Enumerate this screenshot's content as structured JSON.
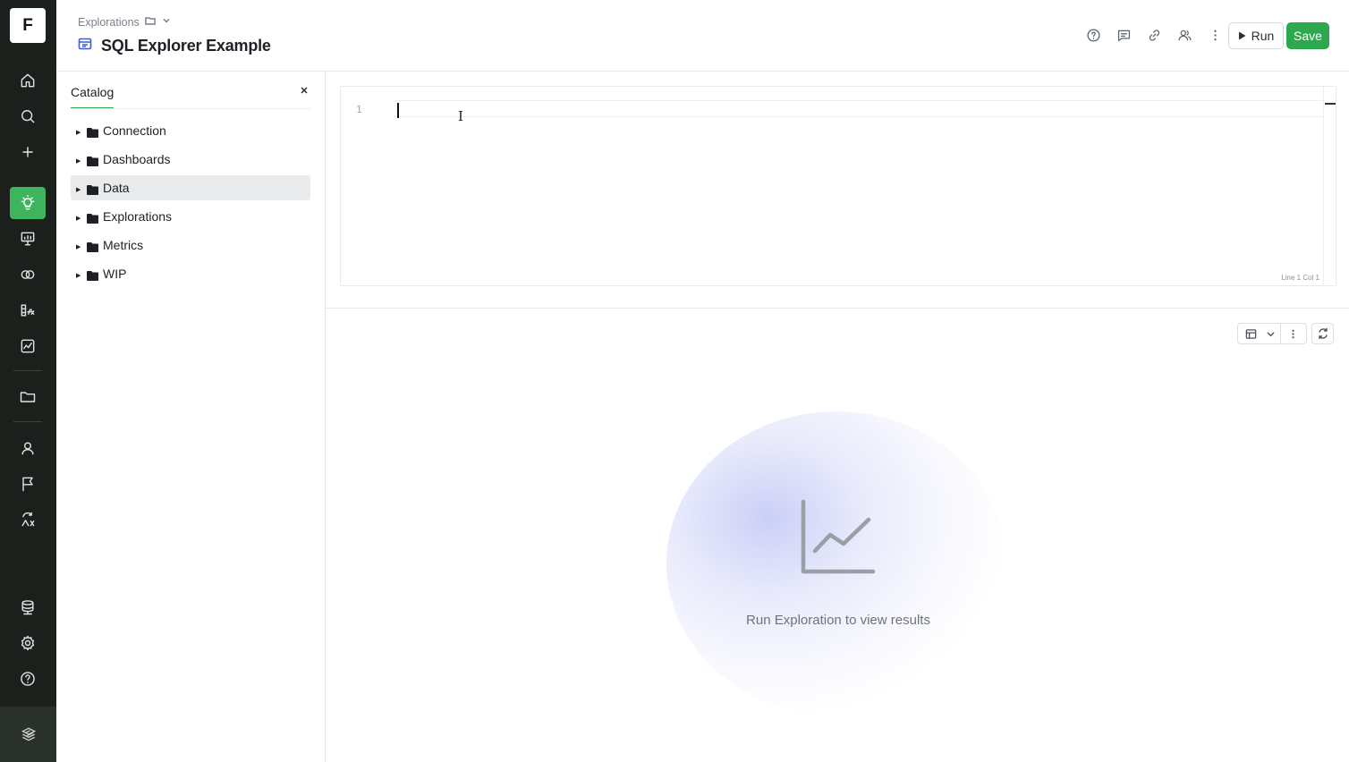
{
  "app": {
    "logo_letter": "F",
    "accent_color": "#3fb45e",
    "rail": {
      "items": [
        {
          "icon": "home-icon"
        },
        {
          "icon": "search-icon"
        },
        {
          "icon": "plus-icon"
        },
        {
          "icon": "explorations-bulb-icon",
          "active": true
        },
        {
          "icon": "presentation-icon"
        },
        {
          "icon": "connections-icon"
        },
        {
          "icon": "metrics-icon"
        },
        {
          "icon": "chart-icon"
        },
        {
          "icon": "folder-icon"
        },
        {
          "icon": "user-icon"
        },
        {
          "icon": "flag-icon"
        },
        {
          "icon": "workflow-icon"
        },
        {
          "icon": "database-icon"
        },
        {
          "icon": "gear-icon"
        },
        {
          "icon": "help-icon"
        }
      ]
    }
  },
  "header": {
    "breadcrumb": "Explorations",
    "title": "SQL Explorer Example",
    "run_label": "Run",
    "save_label": "Save",
    "icons": [
      "help-icon",
      "comment-icon",
      "link-icon",
      "share-users-icon",
      "more-vertical-icon"
    ]
  },
  "catalog": {
    "tab_label": "Catalog",
    "items": [
      {
        "label": "Connection"
      },
      {
        "label": "Dashboards"
      },
      {
        "label": "Data",
        "selected": true
      },
      {
        "label": "Explorations"
      },
      {
        "label": "Metrics"
      },
      {
        "label": "WIP"
      }
    ]
  },
  "editor": {
    "line_number": "1",
    "cursor_position": "Line 1 Col 1"
  },
  "results": {
    "empty_message": "Run Exploration to view results"
  }
}
